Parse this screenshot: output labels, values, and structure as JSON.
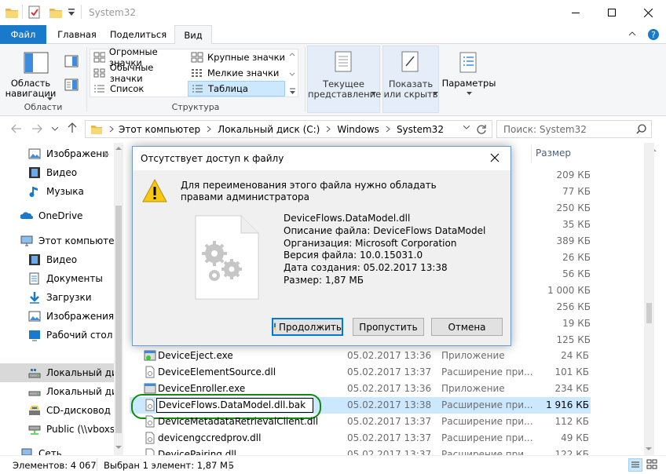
{
  "window": {
    "title": "System32"
  },
  "ribbon_tabs": [
    "Файл",
    "Главная",
    "Поделиться",
    "Вид"
  ],
  "ribbon": {
    "nav_pane_label": "Область навигации",
    "nav_pane_line1": "Область",
    "nav_pane_line2": "навигации",
    "group_areas": "Области",
    "layout_options": [
      "Огромные значки",
      "Крупные значки",
      "Обычные значки",
      "Мелкие значки",
      "Список",
      "Таблица"
    ],
    "group_structure": "Структура",
    "current_view_line1": "Текущее",
    "current_view_line2": "представление",
    "show_hide_line1": "Показать",
    "show_hide_line2": "или скрыть",
    "options": "Параметры"
  },
  "address": {
    "crumbs": [
      "Этот компьютер",
      "Локальный диск (C:)",
      "Windows",
      "System32"
    ],
    "search_placeholder": "Поиск: System32"
  },
  "columns": {
    "size": "Размер"
  },
  "nav_items": [
    {
      "label": "Изображени",
      "icon": "pictures-icon"
    },
    {
      "label": "Видео",
      "icon": "video-icon"
    },
    {
      "label": "Музыка",
      "icon": "music-icon"
    },
    {
      "label": "OneDrive",
      "icon": "onedrive-icon"
    },
    {
      "label": "Этот компьютер",
      "icon": "computer-icon"
    },
    {
      "label": "Видео",
      "icon": "video-icon"
    },
    {
      "label": "Документы",
      "icon": "documents-icon"
    },
    {
      "label": "Загрузки",
      "icon": "downloads-icon"
    },
    {
      "label": "Изображения",
      "icon": "pictures-icon"
    },
    {
      "label": "Рабочий стол",
      "icon": "desktop-icon"
    },
    {
      "label": "Локальный дис",
      "icon": "drive-icon"
    },
    {
      "label": "Локальный дис",
      "icon": "drive-icon"
    },
    {
      "label": "CD-дисковод (E",
      "icon": "cd-icon"
    },
    {
      "label": "Public (\\\\vboxsr",
      "icon": "network-drive-icon"
    },
    {
      "label": "Сеть",
      "icon": "network-icon"
    }
  ],
  "sizes_behind_dialog": [
    "209 КБ",
    "77 КБ",
    "250 КБ",
    "35 КБ",
    "389 КБ",
    "26 КБ",
    "56 КБ",
    "1 000 КБ",
    "256 КБ",
    "19 КБ",
    "125 КБ"
  ],
  "files": [
    {
      "name": "DeviceEject.exe",
      "date": "05.02.2017 13:36",
      "type": "Приложение",
      "size": "24 КБ",
      "icon": "exe-icon"
    },
    {
      "name": "DeviceElementSource.dll",
      "date": "05.02.2017 13:37",
      "type": "Расширение при...",
      "size": "101 КБ",
      "icon": "dll-icon"
    },
    {
      "name": "DeviceEnroller.exe",
      "date": "05.02.2017 13:36",
      "type": "Приложение",
      "size": "234 КБ",
      "icon": "exe-icon"
    },
    {
      "name": "DeviceFlows.DataModel.dll.bak",
      "date": "05.02.2017 13:38",
      "type": "Расширение при...",
      "size": "1 916 КБ",
      "icon": "dll-icon"
    },
    {
      "name": "DeviceMetadataRetrievalClient.dll",
      "date": "05.02.2017 13:37",
      "type": "Расширение при...",
      "size": "112 КБ",
      "icon": "dll-icon"
    },
    {
      "name": "devicengccredprov.dll",
      "date": "05.02.2017 13:37",
      "type": "Расширение при...",
      "size": "49 КБ",
      "icon": "dll-icon"
    },
    {
      "name": "DevicePairing.dll",
      "date": "05.02.2017 13:37",
      "type": "Расширение при...",
      "size": "122 КБ",
      "icon": "dll-icon"
    }
  ],
  "status": {
    "items": "Элементов: 4 067",
    "selected": "Выбран 1 элемент: 1,87 МБ"
  },
  "dialog": {
    "title": "Отсутствует доступ к файлу",
    "message": "Для переименования этого файла нужно обладать правами администратора",
    "file_name": "DeviceFlows.DataModel.dll",
    "description": "Описание файла: DeviceFlows DataModel",
    "company": "Организация: Microsoft Corporation",
    "version": "Версия файла: 10.0.15031.0",
    "created": "Дата создания: 05.02.2017 13:38",
    "size": "Размер: 1,87 МБ",
    "continue": "Продолжить",
    "skip": "Пропустить",
    "cancel": "Отмена"
  },
  "colors": {
    "accent": "#1979ca",
    "selection": "#cce8ff",
    "highlight_ring": "#108b10"
  }
}
